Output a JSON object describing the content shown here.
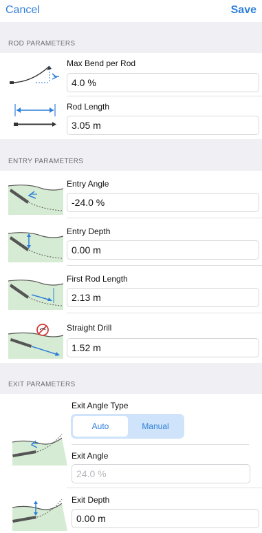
{
  "nav": {
    "cancel_label": "Cancel",
    "save_label": "Save"
  },
  "rod": {
    "header": "ROD PARAMETERS",
    "max_bend": {
      "label": "Max Bend per Rod",
      "value": "4.0 %"
    },
    "rod_length": {
      "label": "Rod Length",
      "value": "3.05 m"
    }
  },
  "entry": {
    "header": "ENTRY PARAMETERS",
    "angle": {
      "label": "Entry Angle",
      "value": "-24.0 %"
    },
    "depth": {
      "label": "Entry Depth",
      "value": "0.00 m"
    },
    "first_rod": {
      "label": "First Rod Length",
      "value": "2.13 m"
    },
    "straight": {
      "label": "Straight Drill",
      "value": "1.52 m"
    }
  },
  "exit": {
    "header": "EXIT PARAMETERS",
    "angle_type": {
      "label": "Exit Angle Type",
      "options": [
        "Auto",
        "Manual"
      ],
      "selected": "Auto"
    },
    "angle": {
      "label": "Exit Angle",
      "value": "24.0 %"
    },
    "depth": {
      "label": "Exit Depth",
      "value": "0.00 m"
    }
  },
  "colors": {
    "accent": "#2f7fd9",
    "ground": "#d6ebd3",
    "segment_bg": "#cfe4fb",
    "header_bg": "#efeff4"
  }
}
